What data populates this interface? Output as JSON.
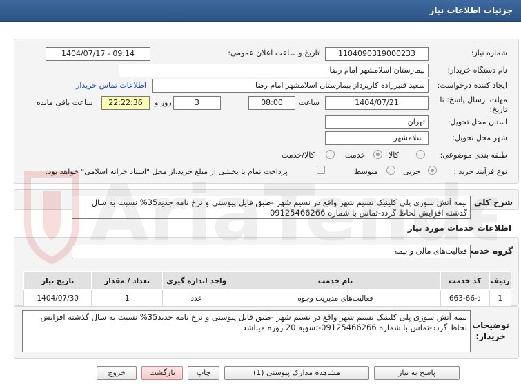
{
  "header": {
    "title": "جزئیات اطلاعات نیاز"
  },
  "form": {
    "need_number_label": "شماره نیاز:",
    "need_number": "1104090319000233",
    "announce_label": "تاریخ و ساعت اعلان عمومی:",
    "announce_value": "1404/07/17 - 09:14",
    "buyer_org_label": "نام دستگاه خریدار:",
    "buyer_org": "بیمارستان اسلامشهر    امام رضا",
    "creator_label": "ایجاد کننده درخواست:",
    "creator": "سعید قنبرزاده کارپرداز بیمارستان اسلامشهر    امام رضا",
    "contact_link": "اطلاعات تماس خریدار",
    "deadline_label": "مهلت ارسال پاسخ: تا تاریخ:",
    "deadline_date": "1404/07/21",
    "time_label": "ساعت",
    "deadline_time": "08:00",
    "days_value": "3",
    "days_label": "روز و",
    "remaining_time": "22:22:36",
    "remaining_label": "ساعت باقی مانده",
    "province_label": "استان محل تحویل:",
    "province": "تهران",
    "city_label": "شهر محل تحویل:",
    "city": "اسلامشهر",
    "category_label": "طبقه بندی موضوعی:",
    "category_options": [
      "کالا",
      "خدمت",
      "کالا/خدمت"
    ],
    "category_selected": "خدمت",
    "process_label": "نوع فرآیند خرید :",
    "process_options": [
      "جزیی",
      "متوسط"
    ],
    "process_selected": "جزیی",
    "payment_note": "پرداخت تمام یا بخشی از مبلغ خرید،از محل \"اسناد خزانه اسلامی\" خواهد بود."
  },
  "need_desc": {
    "label": "شرح کلی نیاز:",
    "text": "بیمه آتش سوزی پلی کلینیک نسیم شهر واقع در نسیم شهر -طبق فایل پیوستی و نرخ نامه جدید35% نسبت به سال گذشته افزایش لحاظ گردد-تماس با شماره 09125466266"
  },
  "services": {
    "section_title": "اطلاعات خدمات مورد نیاز",
    "group_label": "گروه خدمت:",
    "group_value": "فعالیت‌های مالی و بیمه",
    "columns": [
      "ردیف",
      "کد خدمت",
      "نام خدمت",
      "واحد اندازه گیری",
      "تعداد / مقدار",
      "تاریخ نیاز"
    ],
    "rows": [
      [
        "1",
        "ذ-66-663",
        "فعالیت‌های مدیریت وجوه",
        "عدد",
        "1",
        "1404/07/30"
      ]
    ]
  },
  "buyer_notes": {
    "label": "توضیحات خریدار:",
    "text": "بیمه آتش سوزی پلی کلینیک نسیم شهر واقع در نسیم شهر -طبق فایل پیوستی و نرخ نامه جدید35% نسبت به سال گذشته افزایش لحاظ گردد-تماس با شماره 09125466266-تسویه 20 روزه میباشد"
  },
  "buttons": {
    "reply": "پاسخ به نیاز",
    "attachments": "مشاهده مدارک پیوستی (1)",
    "print": "چاپ",
    "back": "بازگشت",
    "exit": "خروج"
  },
  "watermark": {
    "text": "AriaTender.net"
  },
  "colors": {
    "header": "#2c5283",
    "link": "#1a4fc4",
    "remaining_bg": "#fffdb8"
  }
}
